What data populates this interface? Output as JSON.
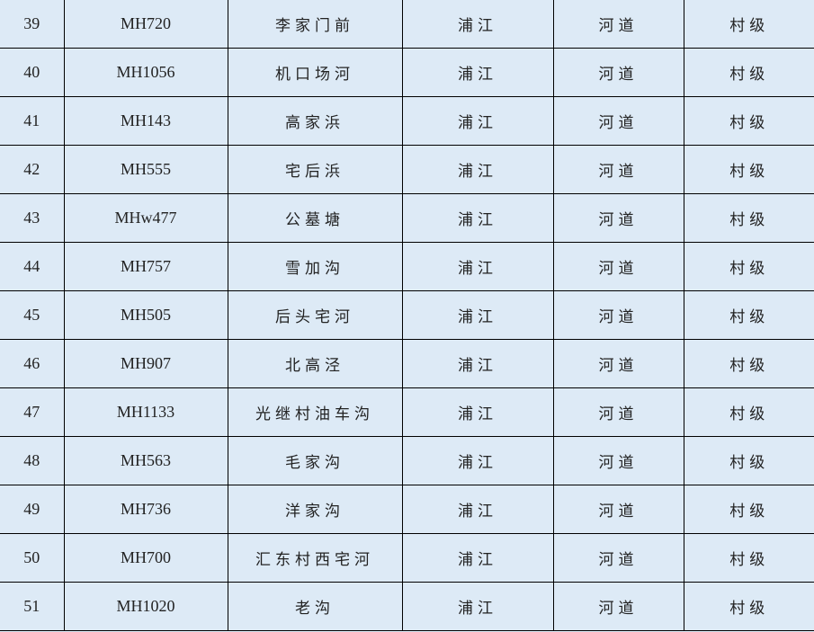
{
  "table": {
    "rows": [
      {
        "no": "39",
        "code": "MH720",
        "name": "李家门前",
        "town": "浦江",
        "type": "河道",
        "level": "村级"
      },
      {
        "no": "40",
        "code": "MH1056",
        "name": "机口场河",
        "town": "浦江",
        "type": "河道",
        "level": "村级"
      },
      {
        "no": "41",
        "code": "MH143",
        "name": "高家浜",
        "town": "浦江",
        "type": "河道",
        "level": "村级"
      },
      {
        "no": "42",
        "code": "MH555",
        "name": "宅后浜",
        "town": "浦江",
        "type": "河道",
        "level": "村级"
      },
      {
        "no": "43",
        "code": "MHw477",
        "name": "公墓塘",
        "town": "浦江",
        "type": "河道",
        "level": "村级"
      },
      {
        "no": "44",
        "code": "MH757",
        "name": "雪加沟",
        "town": "浦江",
        "type": "河道",
        "level": "村级"
      },
      {
        "no": "45",
        "code": "MH505",
        "name": "后头宅河",
        "town": "浦江",
        "type": "河道",
        "level": "村级"
      },
      {
        "no": "46",
        "code": "MH907",
        "name": "北高泾",
        "town": "浦江",
        "type": "河道",
        "level": "村级"
      },
      {
        "no": "47",
        "code": "MH1133",
        "name": "光继村油车沟",
        "town": "浦江",
        "type": "河道",
        "level": "村级"
      },
      {
        "no": "48",
        "code": "MH563",
        "name": "毛家沟",
        "town": "浦江",
        "type": "河道",
        "level": "村级"
      },
      {
        "no": "49",
        "code": "MH736",
        "name": "洋家沟",
        "town": "浦江",
        "type": "河道",
        "level": "村级"
      },
      {
        "no": "50",
        "code": "MH700",
        "name": "汇东村西宅河",
        "town": "浦江",
        "type": "河道",
        "level": "村级"
      },
      {
        "no": "51",
        "code": "MH1020",
        "name": "老沟",
        "town": "浦江",
        "type": "河道",
        "level": "村级"
      }
    ],
    "page_break_after_row": "48"
  }
}
